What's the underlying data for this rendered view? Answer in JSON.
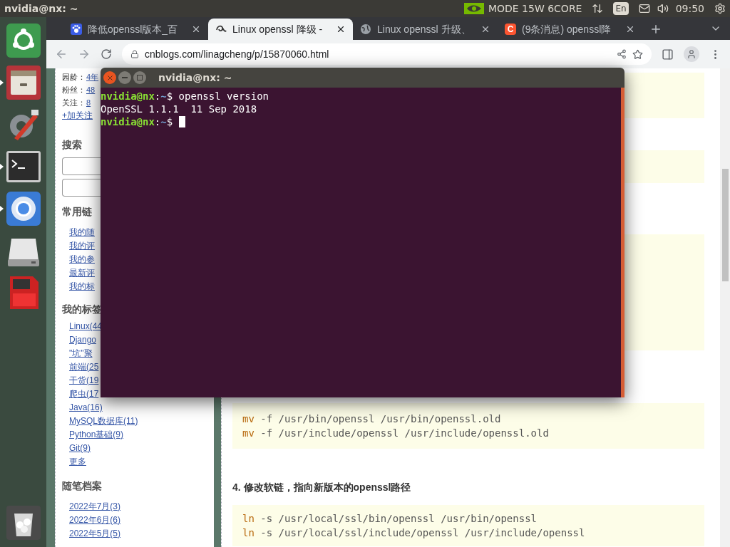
{
  "top_bar": {
    "title": "nvidia@nx: ~",
    "mode": "MODE 15W 6CORE",
    "keyboard": "En",
    "time": "09:50"
  },
  "launcher": [
    {
      "kind": "home",
      "running": false
    },
    {
      "kind": "files",
      "running": true
    },
    {
      "kind": "tools",
      "running": false
    },
    {
      "kind": "terminal",
      "running": true
    },
    {
      "kind": "chromium",
      "running": true
    },
    {
      "kind": "drive",
      "running": false
    },
    {
      "kind": "sdcard",
      "running": false
    },
    {
      "kind": "trash",
      "running": false
    }
  ],
  "browser": {
    "tabs": [
      {
        "kind": "paw",
        "title": "降低openssl版本_百",
        "selected": false
      },
      {
        "kind": "swirl",
        "title": "Linux openssl 降级 -",
        "selected": true
      },
      {
        "kind": "globe",
        "title": "Linux openssl 升级、",
        "selected": false
      },
      {
        "kind": "letter",
        "badge": "C",
        "title": "(9条消息) openssl降",
        "selected": false
      }
    ],
    "address": "cnblogs.com/linagcheng/p/15870060.html"
  },
  "sidebar": {
    "profile": [
      {
        "label": "园龄：",
        "value": "4年"
      },
      {
        "label": "粉丝：",
        "value": "48"
      },
      {
        "label": "关注：",
        "value": "8"
      }
    ],
    "follow": "+加关注",
    "search_title": "搜索",
    "links_title": "常用链",
    "links": [
      "我的随",
      "我的评",
      "我的参",
      "最新评",
      "我的标"
    ],
    "tags_title": "我的标签",
    "tags": [
      "Linux(44",
      "Django",
      "\"坑\"聚",
      "前端(25",
      "干货(19",
      "爬虫(17",
      "Java(16)",
      "MySQL数据库(11)",
      "Python基础(9)",
      "Git(9)",
      "更多"
    ],
    "archive_title": "随笔档案",
    "archive": [
      "2022年7月(3)",
      "2022年6月(6)",
      "2022年5月(5)"
    ]
  },
  "article": [
    {
      "kind": "code"
    },
    {
      "kind": "code"
    },
    {
      "kind": "code"
    },
    {
      "kind": "code",
      "lines": [
        {
          "cmd": "mv",
          "args": " -f /usr/bin/openssl /usr/bin/openssl.old"
        },
        {
          "cmd": "mv",
          "args": " -f /usr/include/openssl /usr/include/openssl.old"
        }
      ]
    },
    {
      "kind": "heading",
      "text": "4. 修改软链，指向新版本的openssl路径"
    },
    {
      "kind": "code",
      "lines": [
        {
          "cmd": "ln",
          "args": " -s /usr/local/ssl/bin/openssl /usr/bin/openssl"
        },
        {
          "cmd": "ln",
          "args": " -s /usr/local/ssl/include/openssl /usr/include/openssl"
        }
      ]
    }
  ],
  "terminal": {
    "title": "nvidia@nx: ~",
    "lines": [
      {
        "kind": "prompt",
        "user": "nvidia@nx",
        "sep": ":",
        "path": "~",
        "symbol": "$",
        "command": " openssl version",
        "cursor": false
      },
      {
        "kind": "output",
        "text": "OpenSSL 1.1.1  11 Sep 2018"
      },
      {
        "kind": "prompt",
        "user": "nvidia@nx",
        "sep": ":",
        "path": "~",
        "symbol": "$",
        "cursor": true
      }
    ]
  }
}
